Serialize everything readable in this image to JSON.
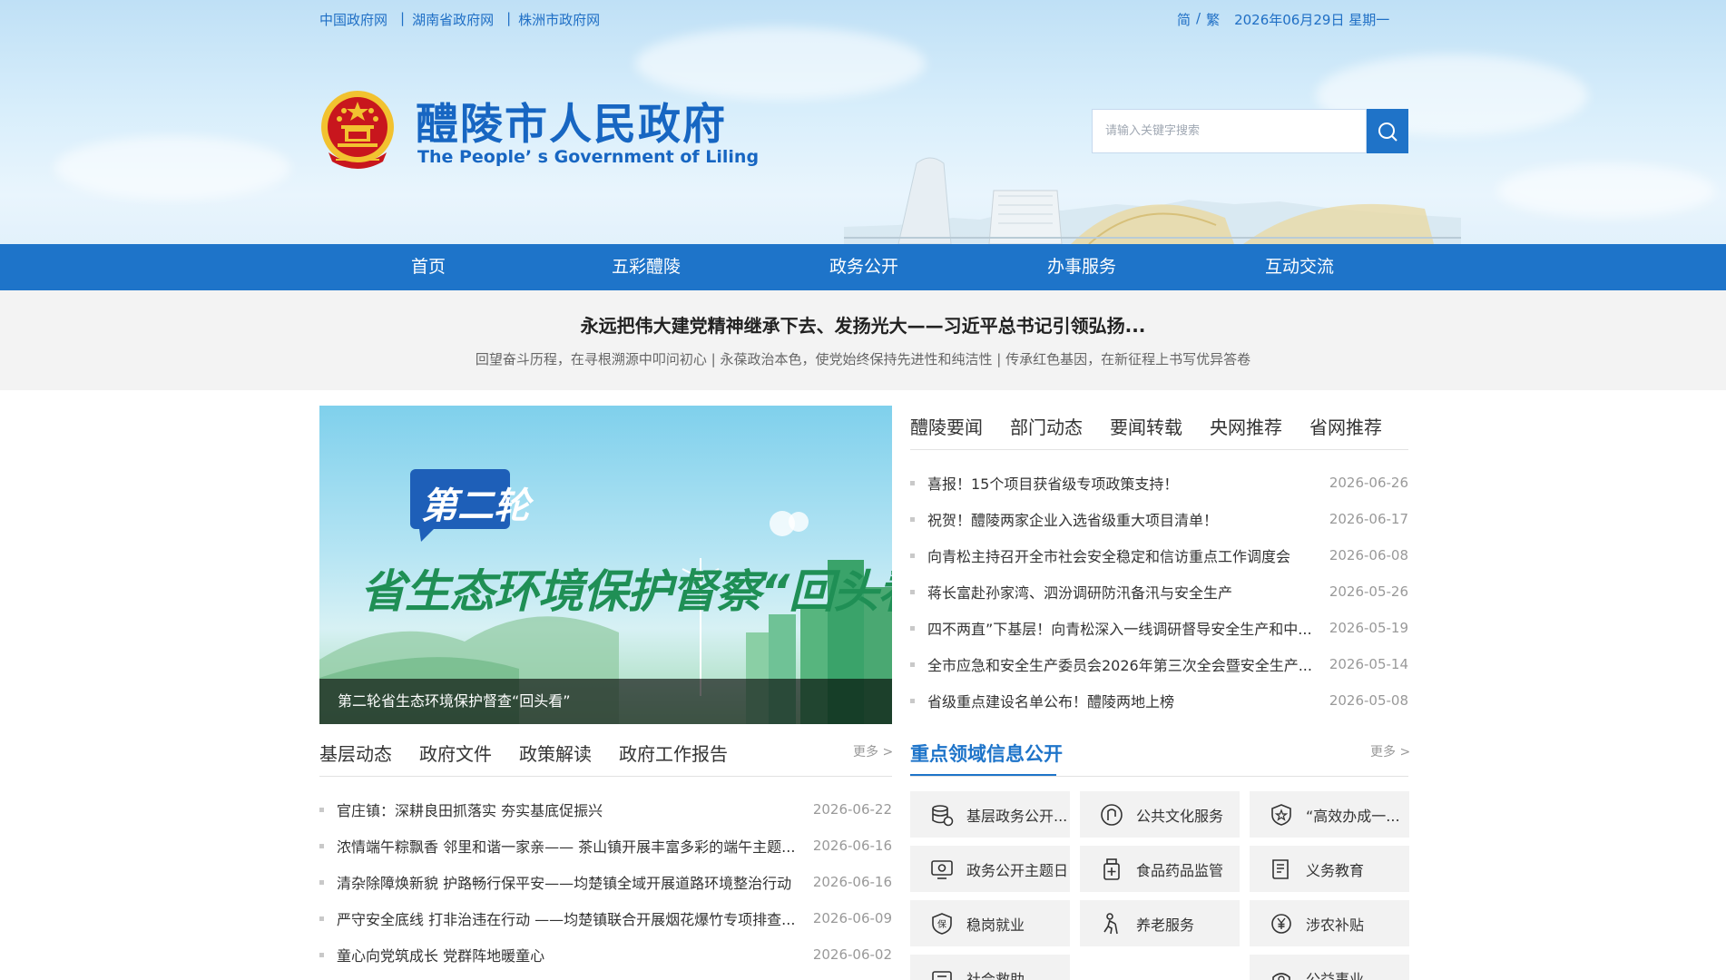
{
  "top_bar": {
    "links": [
      "中国政府网",
      "湖南省政府网",
      "株洲市政府网"
    ],
    "lang_simplified": "简",
    "lang_sep": "/",
    "lang_traditional": "繁",
    "date": "2026年06月29日 星期一"
  },
  "header": {
    "title": "醴陵市人民政府",
    "subtitle": "The People’ s Government of Liling",
    "search_placeholder": "请输入关键字搜索"
  },
  "nav": {
    "items": [
      "首页",
      "五彩醴陵",
      "政务公开",
      "办事服务",
      "互动交流"
    ]
  },
  "headline": {
    "title": "永远把伟大建党精神继承下去、发扬光大——习近平总书记引领弘扬...",
    "sub": "回望奋斗历程，在寻根溯源中叩问初心 | 永葆政治本色，使党始终保持先进性和纯洁性 | 传承红色基因，在新征程上书写优异答卷"
  },
  "feature": {
    "badge": "第二轮",
    "banner_text": "省生态环境保护督察“回头看”专栏",
    "caption": "第二轮省生态环境保护督查“回头看”"
  },
  "news_tabs": {
    "tabs": [
      "醴陵要闻",
      "部门动态",
      "要闻转载",
      "央网推荐",
      "省网推荐"
    ],
    "items": [
      {
        "title": "喜报！15个项目获省级专项政策支持！",
        "date": "2026-06-26"
      },
      {
        "title": "祝贺！醴陵两家企业入选省级重大项目清单！",
        "date": "2026-06-17"
      },
      {
        "title": "向青松主持召开全市社会安全稳定和信访重点工作调度会",
        "date": "2026-06-08"
      },
      {
        "title": "蒋长富赴孙家湾、泗汾调研防汛备汛与安全生产",
        "date": "2026-05-26"
      },
      {
        "title": "四不两直”下基层！向青松深入一线调研督导安全生产和中...",
        "date": "2026-05-19"
      },
      {
        "title": "全市应急和安全生产委员会2026年第三次全会暨安全生产...",
        "date": "2026-05-14"
      },
      {
        "title": "省级重点建设名单公布！醴陵两地上榜",
        "date": "2026-05-08"
      }
    ]
  },
  "grassroots": {
    "tabs": [
      "基层动态",
      "政府文件",
      "政策解读",
      "政府工作报告"
    ],
    "more": "更多 >",
    "items": [
      {
        "title": "官庄镇：深耕良田抓落实 夯实基底促振兴",
        "date": "2026-06-22"
      },
      {
        "title": "浓情端午粽飘香 邻里和谐一家亲—— 茶山镇开展丰富多彩的端午主题...",
        "date": "2026-06-16"
      },
      {
        "title": "清杂除障焕新貌 护路畅行保平安——均楚镇全域开展道路环境整治行动",
        "date": "2026-06-16"
      },
      {
        "title": "严守安全底线 打非治违在行动 ——均楚镇联合开展烟花爆竹专项排查...",
        "date": "2026-06-09"
      },
      {
        "title": "童心向党筑成长 党群阵地暖童心",
        "date": "2026-06-02"
      }
    ]
  },
  "key_areas": {
    "title": "重点领域信息公开",
    "more": "更多 >",
    "items": [
      {
        "label": "基层政务公开...",
        "icon": "database-icon"
      },
      {
        "label": "公共文化服务",
        "icon": "culture-icon"
      },
      {
        "label": "“高效办成一...",
        "icon": "shield-star-icon"
      },
      {
        "label": "政务公开主题日",
        "icon": "eye-icon"
      },
      {
        "label": "食品药品监管",
        "icon": "medicine-icon"
      },
      {
        "label": "义务教育",
        "icon": "book-icon"
      },
      {
        "label": "稳岗就业",
        "icon": "badge-icon"
      },
      {
        "label": "养老服务",
        "icon": "elder-icon"
      },
      {
        "label": "涉农补贴",
        "icon": "yuan-icon"
      },
      {
        "label": "社会救助",
        "icon": "aid-icon"
      },
      {
        "label": "公益事业",
        "icon": "charity-icon"
      }
    ]
  },
  "colors": {
    "primary": "#1e74c9",
    "title_blue": "#1766c2",
    "emblem_red": "#c8161d",
    "emblem_gold": "#f2c230"
  }
}
